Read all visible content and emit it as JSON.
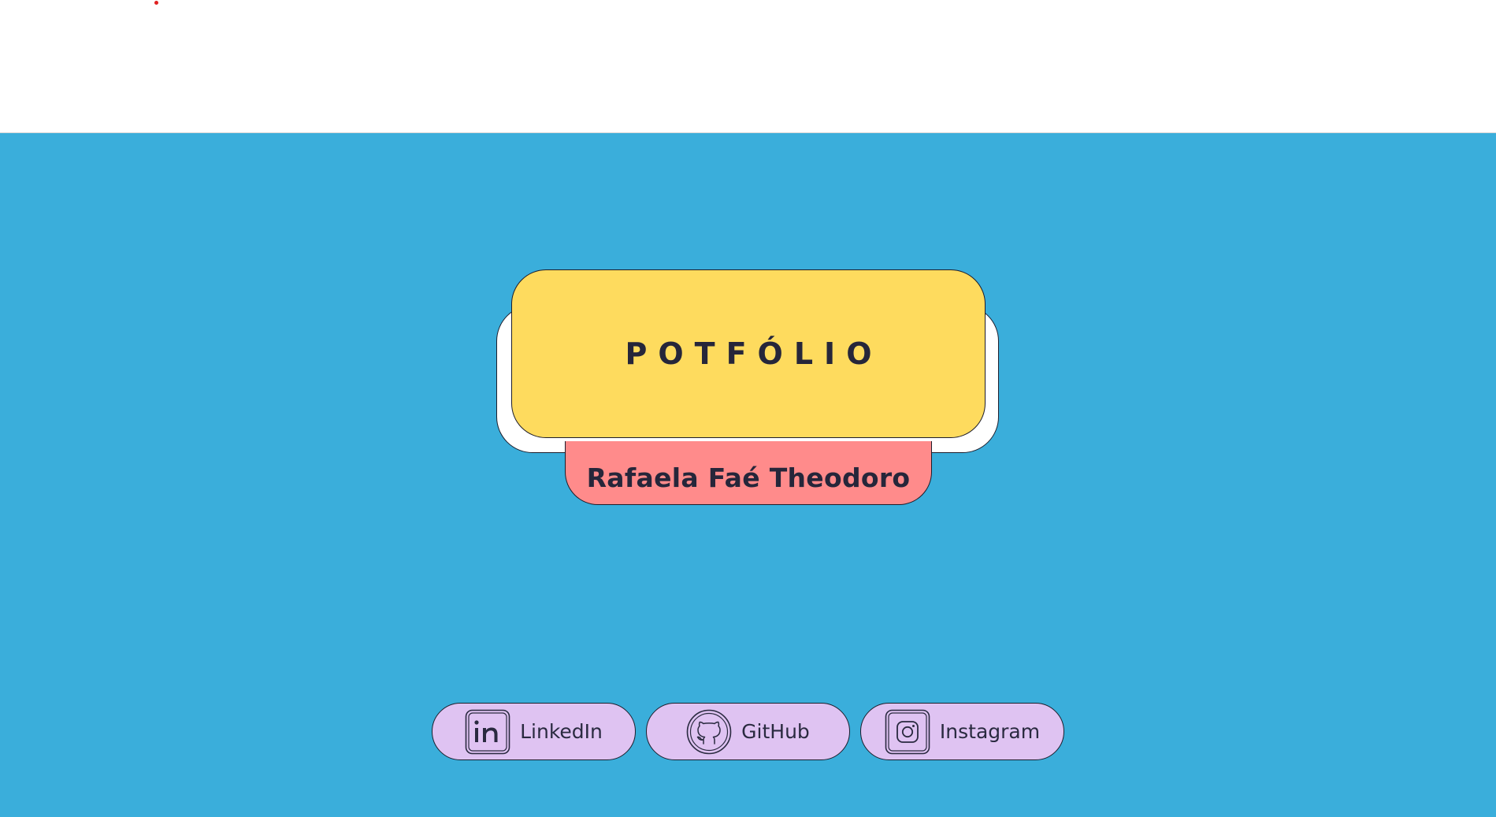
{
  "colors": {
    "header_bg": "#ffffff",
    "hero_bg": "#3aaedb",
    "title_card_bg": "#fedb5e",
    "name_card_bg": "#ff8b8b",
    "back_card_bg": "#ffffff",
    "social_bg": "#dfc3f2",
    "text_dark": "#26263a",
    "dot_red": "#e02020"
  },
  "hero": {
    "title": "POTFÓLIO",
    "name": "Rafaela Faé Theodoro"
  },
  "social": [
    {
      "label": "LinkedIn",
      "icon": "linkedin-icon"
    },
    {
      "label": "GitHub",
      "icon": "github-icon"
    },
    {
      "label": "Instagram",
      "icon": "instagram-icon"
    }
  ]
}
